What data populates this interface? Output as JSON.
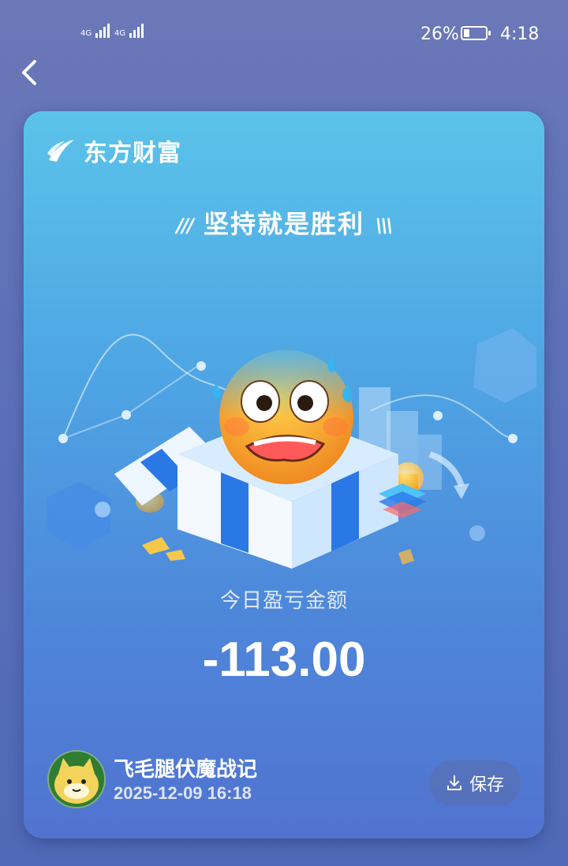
{
  "status_bar": {
    "signal1": "4G",
    "signal2": "4G",
    "battery_percent": "26%",
    "battery_level": 0.26,
    "time": "4:18"
  },
  "card": {
    "brand": "东方财富",
    "slogan": "坚持就是胜利",
    "pnl_label": "今日盈亏金额",
    "pnl_value": "-113.00",
    "user_name": "飞毛腿伏魔战记",
    "timestamp": "2025-12-09 16:18",
    "save_label": "保存"
  },
  "icons": {
    "back": "chevron-left-icon",
    "download": "download-icon",
    "logo": "eastmoney-logo-icon"
  },
  "colors": {
    "card_top": "#5bc3ea",
    "card_bottom": "#5173d0",
    "page_bg": "#5d70b8"
  }
}
